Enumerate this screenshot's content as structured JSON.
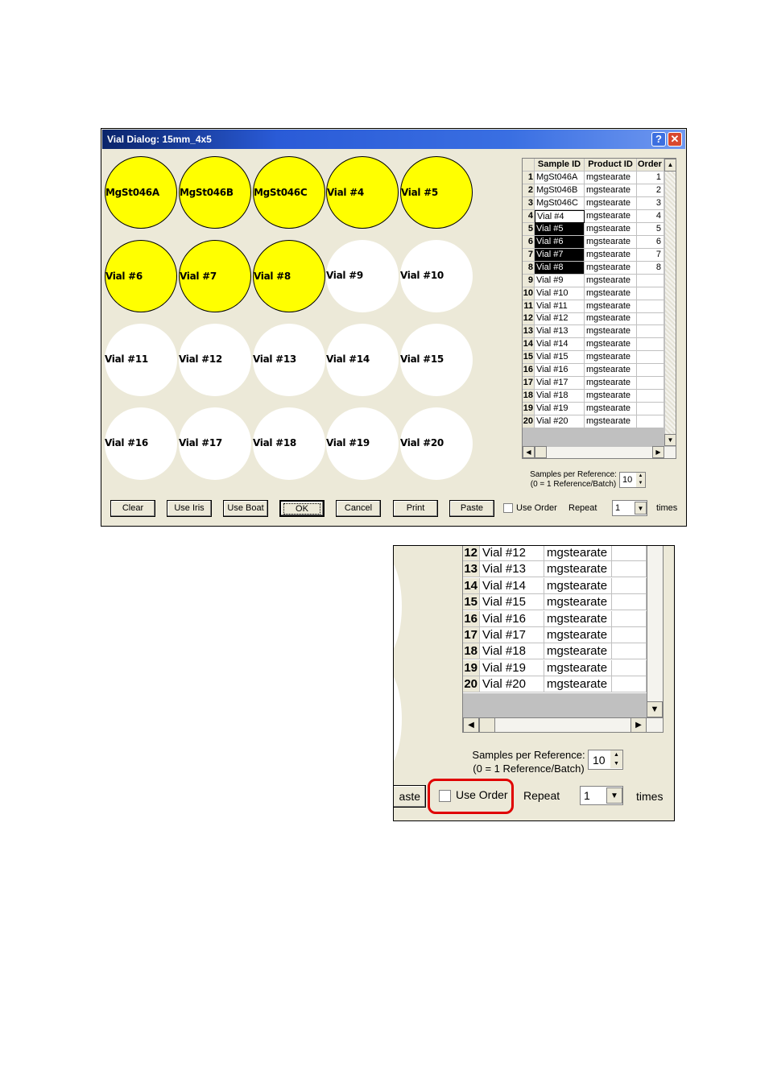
{
  "dialog": {
    "title": "Vial Dialog: 15mm_4x5",
    "help_glyph": "?",
    "close_glyph": "✕",
    "colors": {
      "filled_vial": "#ffff00",
      "empty_vial": "#ffffff",
      "selection": "#000000",
      "highlight": "#e00000"
    }
  },
  "vials": [
    {
      "label": "MgSt046A",
      "filled": true
    },
    {
      "label": "MgSt046B",
      "filled": true
    },
    {
      "label": "MgSt046C",
      "filled": true
    },
    {
      "label": "Vial #4",
      "filled": true
    },
    {
      "label": "Vial #5",
      "filled": true
    },
    {
      "label": "Vial #6",
      "filled": true
    },
    {
      "label": "Vial #7",
      "filled": true
    },
    {
      "label": "Vial #8",
      "filled": true
    },
    {
      "label": "Vial #9",
      "filled": false
    },
    {
      "label": "Vial #10",
      "filled": false
    },
    {
      "label": "Vial #11",
      "filled": false
    },
    {
      "label": "Vial #12",
      "filled": false
    },
    {
      "label": "Vial #13",
      "filled": false
    },
    {
      "label": "Vial #14",
      "filled": false
    },
    {
      "label": "Vial #15",
      "filled": false
    },
    {
      "label": "Vial #16",
      "filled": false
    },
    {
      "label": "Vial #17",
      "filled": false
    },
    {
      "label": "Vial #18",
      "filled": false
    },
    {
      "label": "Vial #19",
      "filled": false
    },
    {
      "label": "Vial #20",
      "filled": false
    }
  ],
  "grid": {
    "headers": [
      "Sample ID",
      "Product ID",
      "Order"
    ],
    "sort_glyph": "▲",
    "rows": [
      {
        "n": "1",
        "sample": "MgSt046A",
        "product": "mgstearate",
        "order": "1"
      },
      {
        "n": "2",
        "sample": "MgSt046B",
        "product": "mgstearate",
        "order": "2"
      },
      {
        "n": "3",
        "sample": "MgSt046C",
        "product": "mgstearate",
        "order": "3"
      },
      {
        "n": "4",
        "sample": "Vial #4",
        "product": "mgstearate",
        "order": "4"
      },
      {
        "n": "5",
        "sample": "Vial #5",
        "product": "mgstearate",
        "order": "5"
      },
      {
        "n": "6",
        "sample": "Vial #6",
        "product": "mgstearate",
        "order": "6"
      },
      {
        "n": "7",
        "sample": "Vial #7",
        "product": "mgstearate",
        "order": "7"
      },
      {
        "n": "8",
        "sample": "Vial #8",
        "product": "mgstearate",
        "order": "8"
      },
      {
        "n": "9",
        "sample": "Vial #9",
        "product": "mgstearate",
        "order": ""
      },
      {
        "n": "10",
        "sample": "Vial #10",
        "product": "mgstearate",
        "order": ""
      },
      {
        "n": "11",
        "sample": "Vial #11",
        "product": "mgstearate",
        "order": ""
      },
      {
        "n": "12",
        "sample": "Vial #12",
        "product": "mgstearate",
        "order": ""
      },
      {
        "n": "13",
        "sample": "Vial #13",
        "product": "mgstearate",
        "order": ""
      },
      {
        "n": "14",
        "sample": "Vial #14",
        "product": "mgstearate",
        "order": ""
      },
      {
        "n": "15",
        "sample": "Vial #15",
        "product": "mgstearate",
        "order": ""
      },
      {
        "n": "16",
        "sample": "Vial #16",
        "product": "mgstearate",
        "order": ""
      },
      {
        "n": "17",
        "sample": "Vial #17",
        "product": "mgstearate",
        "order": ""
      },
      {
        "n": "18",
        "sample": "Vial #18",
        "product": "mgstearate",
        "order": ""
      },
      {
        "n": "19",
        "sample": "Vial #19",
        "product": "mgstearate",
        "order": ""
      },
      {
        "n": "20",
        "sample": "Vial #20",
        "product": "mgstearate",
        "order": ""
      }
    ]
  },
  "samples_per_reference": {
    "label_line1": "Samples per Reference:",
    "label_line2": "(0 = 1 Reference/Batch)",
    "value": "10"
  },
  "buttons": {
    "clear": "Clear",
    "use_iris": "Use Iris",
    "use_boat": "Use Boat",
    "ok": "OK",
    "cancel": "Cancel",
    "print": "Print",
    "paste": "Paste"
  },
  "use_order": {
    "label": "Use Order",
    "checked": false
  },
  "repeat": {
    "label": "Repeat",
    "value": "1",
    "suffix": "times"
  },
  "zoom": {
    "paste_fragment": "aste",
    "rows": [
      {
        "n": "12",
        "sample": "Vial #12",
        "product": "mgstearate"
      },
      {
        "n": "13",
        "sample": "Vial #13",
        "product": "mgstearate"
      },
      {
        "n": "14",
        "sample": "Vial #14",
        "product": "mgstearate"
      },
      {
        "n": "15",
        "sample": "Vial #15",
        "product": "mgstearate"
      },
      {
        "n": "16",
        "sample": "Vial #16",
        "product": "mgstearate"
      },
      {
        "n": "17",
        "sample": "Vial #17",
        "product": "mgstearate"
      },
      {
        "n": "18",
        "sample": "Vial #18",
        "product": "mgstearate"
      },
      {
        "n": "19",
        "sample": "Vial #19",
        "product": "mgstearate"
      },
      {
        "n": "20",
        "sample": "Vial #20",
        "product": "mgstearate"
      }
    ]
  }
}
